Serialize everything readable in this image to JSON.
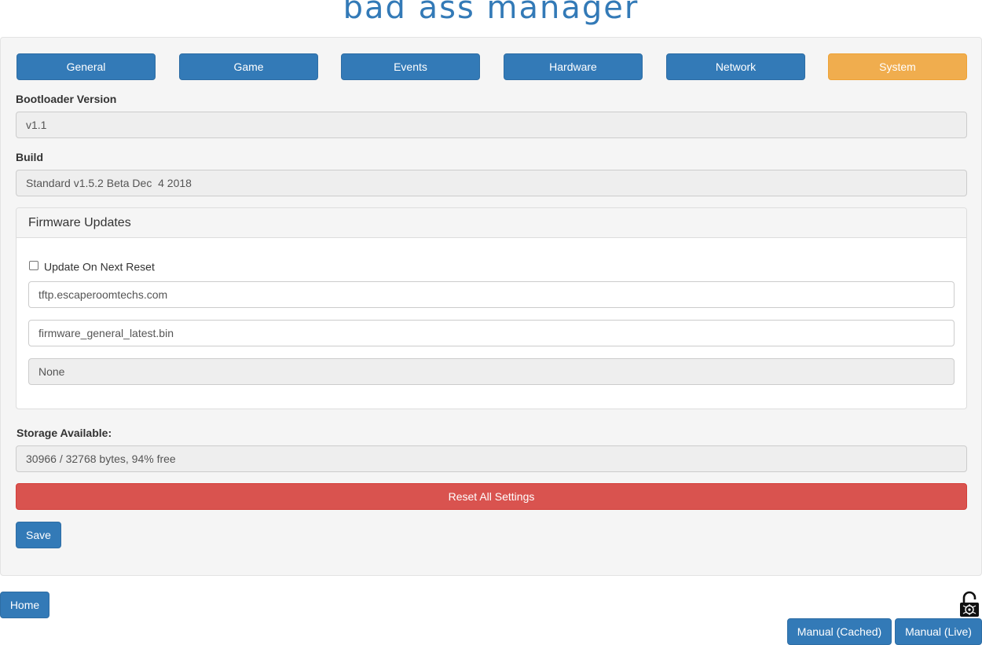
{
  "header": {
    "logo_text": "bad ass manager"
  },
  "tabs": [
    {
      "label": "General"
    },
    {
      "label": "Game"
    },
    {
      "label": "Events"
    },
    {
      "label": "Hardware"
    },
    {
      "label": "Network"
    },
    {
      "label": "System",
      "active": true
    }
  ],
  "system": {
    "bootloader": {
      "label": "Bootloader Version",
      "value": "v1.1"
    },
    "build": {
      "label": "Build",
      "value": "Standard v1.5.2 Beta Dec  4 2018"
    },
    "firmware": {
      "title": "Firmware Updates",
      "update_on_reset_label": "Update On Next Reset",
      "update_on_reset_checked": false,
      "server": "tftp.escaperoomtechs.com",
      "filename": "firmware_general_latest.bin",
      "status": "None"
    },
    "storage": {
      "label": "Storage Available:",
      "value": "30966 / 32768 bytes, 94% free"
    },
    "reset_label": "Reset All Settings",
    "save_label": "Save"
  },
  "footer": {
    "home_label": "Home",
    "manual_cached_label": "Manual (Cached)",
    "manual_live_label": "Manual (Live)",
    "lock_icon": "padlock-open-icon"
  },
  "colors": {
    "primary": "#337ab7",
    "warning": "#f0ad4e",
    "danger": "#d9534f"
  }
}
